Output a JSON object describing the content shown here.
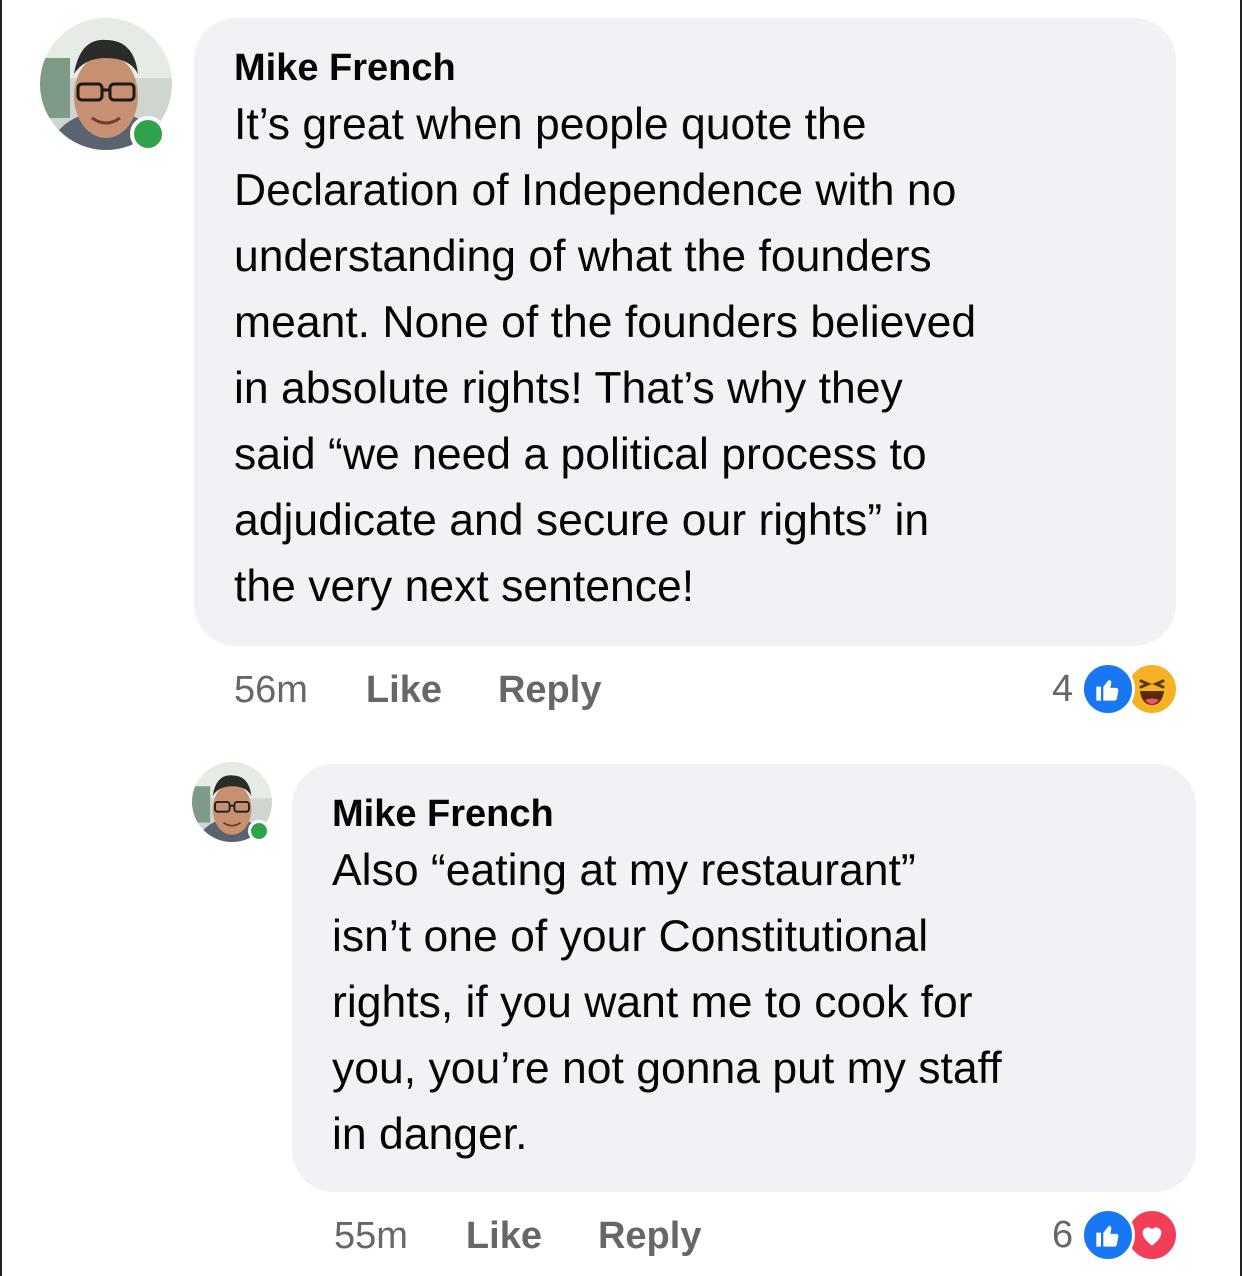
{
  "comments": [
    {
      "author": "Mike French",
      "text": "It’s great when people quote the\nDeclaration of Independence with no\nunderstanding of what the founders\nmeant. None of the founders believed\nin absolute rights!  That’s why they\nsaid “we need a political process to\nadjudicate and secure our rights” in\nthe very next sentence!",
      "time": "56m",
      "like_label": "Like",
      "reply_label": "Reply",
      "reaction_count": "4",
      "reactions": [
        "like-icon",
        "haha-icon"
      ]
    },
    {
      "author": "Mike French",
      "text": "Also “eating at my restaurant”\nisn’t one of your Constitutional\nrights, if you want me to cook for\nyou, you’re not gonna put my staff\nin danger.",
      "time": "55m",
      "like_label": "Like",
      "reply_label": "Reply",
      "reaction_count": "6",
      "reactions": [
        "like-icon",
        "love-icon"
      ]
    }
  ],
  "colors": {
    "bubble": "#f0f2f5",
    "meta_text": "#65676b",
    "online": "#31a24c",
    "like": "#1877f2",
    "haha": "#f7b125",
    "love": "#f33e58"
  }
}
